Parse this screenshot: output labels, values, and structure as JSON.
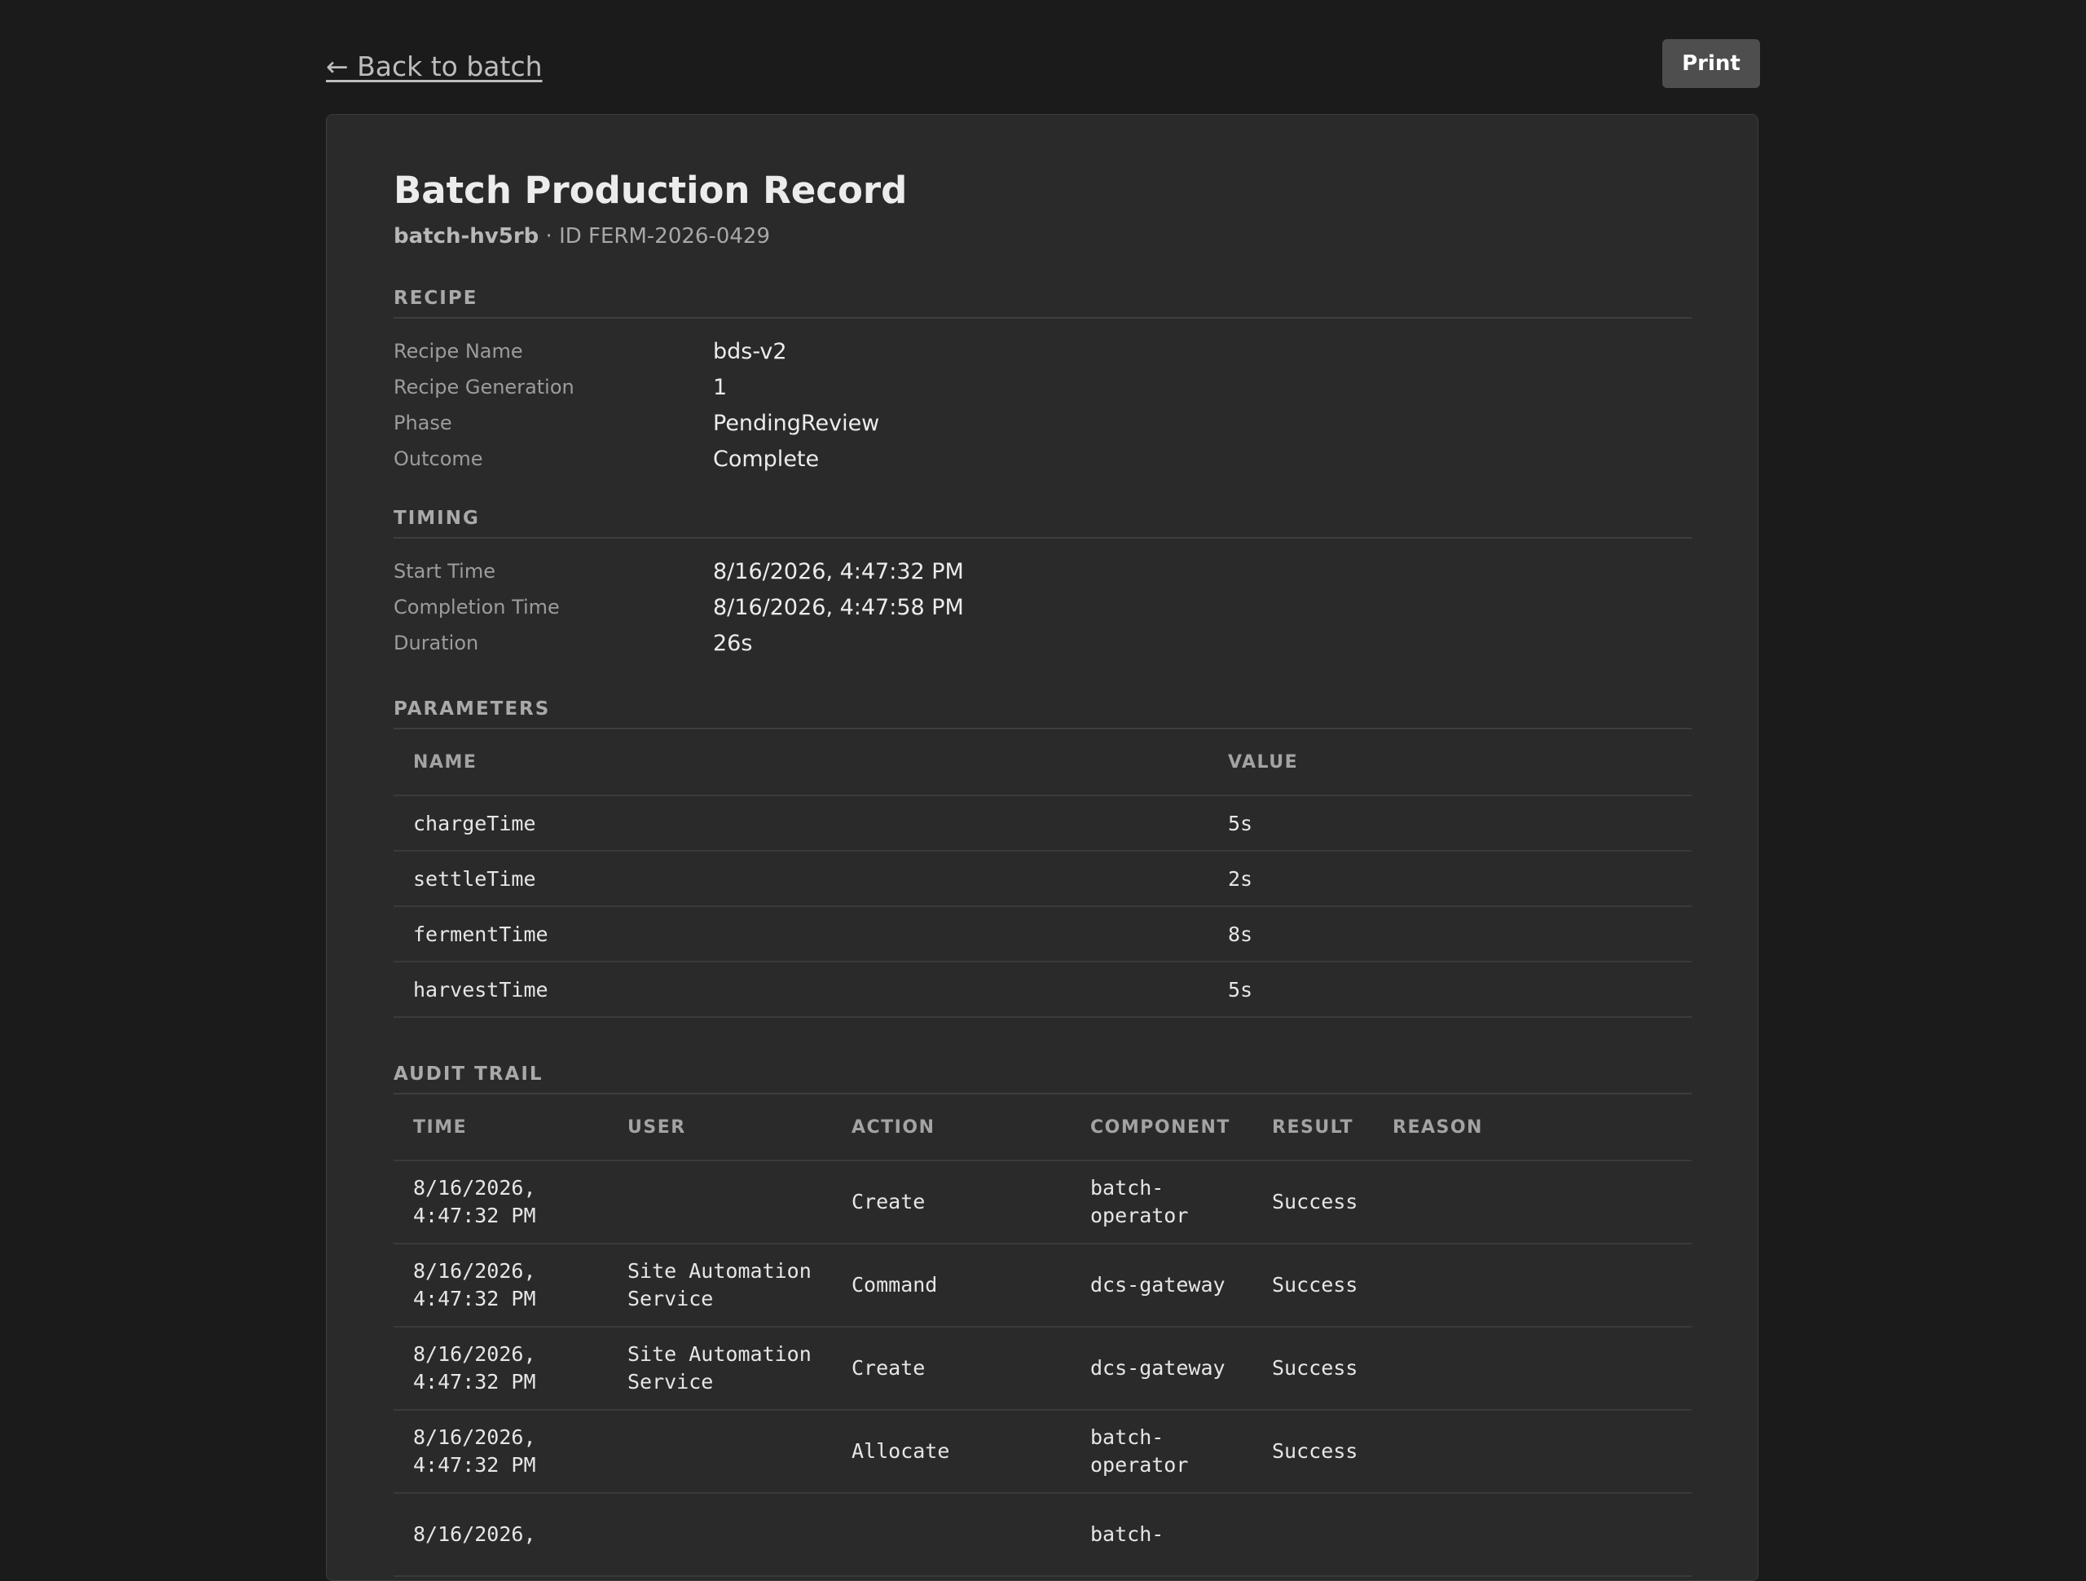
{
  "nav": {
    "back_label": "← Back to batch",
    "print_label": "Print"
  },
  "record": {
    "title": "Batch Production Record",
    "batch_name": "batch-hv5rb",
    "batch_id_text": " · ID FERM-2026-0429"
  },
  "recipe": {
    "heading": "RECIPE",
    "rows": [
      {
        "label": "Recipe Name",
        "value": "bds-v2"
      },
      {
        "label": "Recipe Generation",
        "value": "1"
      },
      {
        "label": "Phase",
        "value": "PendingReview"
      },
      {
        "label": "Outcome",
        "value": "Complete"
      }
    ]
  },
  "timing": {
    "heading": "TIMING",
    "rows": [
      {
        "label": "Start Time",
        "value": "8/16/2026, 4:47:32 PM"
      },
      {
        "label": "Completion Time",
        "value": "8/16/2026, 4:47:58 PM"
      },
      {
        "label": "Duration",
        "value": "26s"
      }
    ]
  },
  "parameters": {
    "heading": "PARAMETERS",
    "columns": [
      "NAME",
      "VALUE"
    ],
    "rows": [
      {
        "name": "chargeTime",
        "value": "5s"
      },
      {
        "name": "settleTime",
        "value": "2s"
      },
      {
        "name": "fermentTime",
        "value": "8s"
      },
      {
        "name": "harvestTime",
        "value": "5s"
      }
    ]
  },
  "audit": {
    "heading": "AUDIT TRAIL",
    "columns": [
      "TIME",
      "USER",
      "ACTION",
      "COMPONENT",
      "RESULT",
      "REASON"
    ],
    "rows": [
      {
        "time_date": "8/16/2026,",
        "time_clock": "4:47:32 PM",
        "user_line1": "",
        "user_line2": "",
        "action": "Create",
        "component_line1": "batch-",
        "component_line2": "operator",
        "result": "Success",
        "reason": ""
      },
      {
        "time_date": "8/16/2026,",
        "time_clock": "4:47:32 PM",
        "user_line1": "Site Automation",
        "user_line2": "Service",
        "action": "Command",
        "component_line1": "dcs-gateway",
        "component_line2": "",
        "result": "Success",
        "reason": ""
      },
      {
        "time_date": "8/16/2026,",
        "time_clock": "4:47:32 PM",
        "user_line1": "Site Automation",
        "user_line2": "Service",
        "action": "Create",
        "component_line1": "dcs-gateway",
        "component_line2": "",
        "result": "Success",
        "reason": ""
      },
      {
        "time_date": "8/16/2026,",
        "time_clock": "4:47:32 PM",
        "user_line1": "",
        "user_line2": "",
        "action": "Allocate",
        "component_line1": "batch-",
        "component_line2": "operator",
        "result": "Success",
        "reason": ""
      },
      {
        "time_date": "8/16/2026,",
        "time_clock": "",
        "user_line1": "",
        "user_line2": "",
        "action": "",
        "component_line1": "batch-",
        "component_line2": "",
        "result": "",
        "reason": ""
      }
    ]
  }
}
